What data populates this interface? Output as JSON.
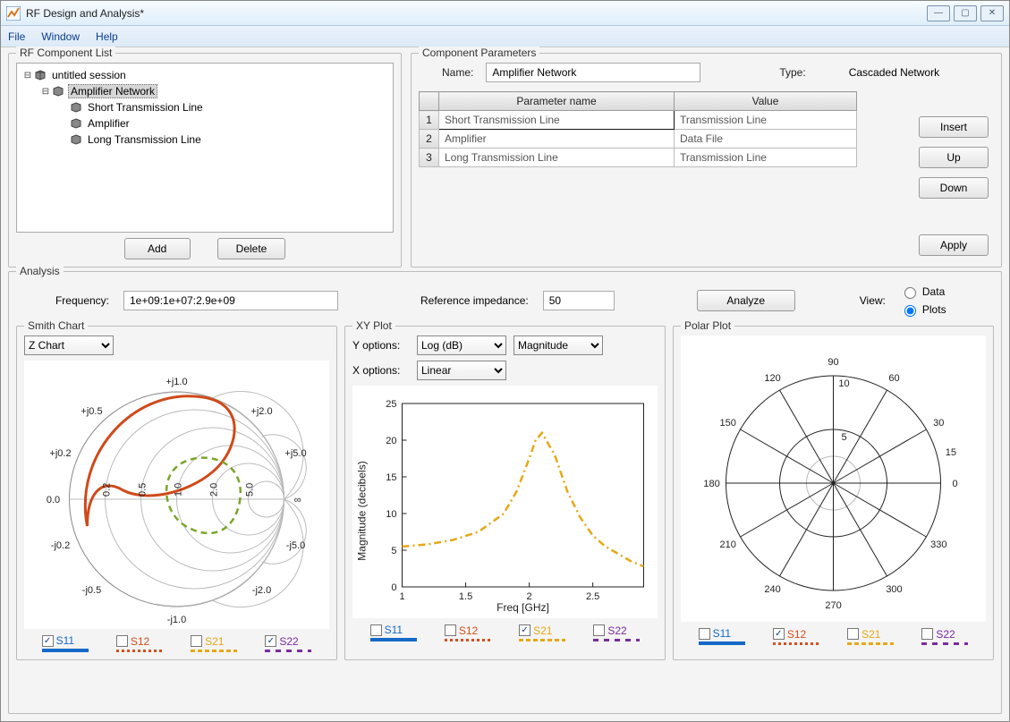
{
  "window": {
    "title": "RF Design and Analysis*"
  },
  "menu": {
    "file": "File",
    "window": "Window",
    "help": "Help"
  },
  "component_list": {
    "legend": "RF Component List",
    "root": "untitled session",
    "selected": "Amplifier Network",
    "children": [
      "Short Transmission Line",
      "Amplifier",
      "Long Transmission Line"
    ],
    "add": "Add",
    "delete": "Delete"
  },
  "params": {
    "legend": "Component Parameters",
    "name_label": "Name:",
    "name_value": "Amplifier Network",
    "type_label": "Type:",
    "type_value": "Cascaded Network",
    "col_param": "Parameter name",
    "col_value": "Value",
    "rows": [
      {
        "n": "1",
        "p": "Short Transmission Line",
        "v": "Transmission Line"
      },
      {
        "n": "2",
        "p": "Amplifier",
        "v": "Data File"
      },
      {
        "n": "3",
        "p": "Long Transmission Line",
        "v": "Transmission Line"
      }
    ],
    "insert": "Insert",
    "up": "Up",
    "down": "Down",
    "apply": "Apply"
  },
  "analysis": {
    "legend": "Analysis",
    "freq_label": "Frequency:",
    "freq_value": "1e+09:1e+07:2.9e+09",
    "ref_label": "Reference impedance:",
    "ref_value": "50",
    "analyze": "Analyze",
    "view_label": "View:",
    "data": "Data",
    "plots": "Plots"
  },
  "smith": {
    "legend": "Smith Chart",
    "zchart": "Z Chart",
    "labels": {
      "pj10": "+j1.0",
      "pj05": "+j0.5",
      "pj20": "+j2.0",
      "pj02": "+j0.2",
      "pj50": "+j5.0",
      "zero": "0.0",
      "inf": "∞",
      "mj02": "-j0.2",
      "mj50": "-j5.0",
      "mj05": "-j0.5",
      "mj20": "-j2.0",
      "mj10": "-j1.0",
      "r02": "0.2",
      "r05": "0.5",
      "r10": "1.0",
      "r20": "2.0",
      "r50": "5.0"
    }
  },
  "xy": {
    "legend": "XY Plot",
    "yopt_label": "Y options:",
    "xopt_label": "X options:",
    "yopt1": "Log (dB)",
    "yopt2": "Magnitude",
    "xopt": "Linear",
    "ylabel": "Magnitude (decibels)",
    "xlabel": "Freq [GHz]"
  },
  "polar": {
    "legend": "Polar Plot"
  },
  "sparam": {
    "s11": "S11",
    "s12": "S12",
    "s21": "S21",
    "s22": "S22"
  },
  "chart_data": [
    {
      "type": "smith",
      "title": "Smith Chart (Z Chart)",
      "series": [
        {
          "name": "S11",
          "style": "solid",
          "color": "#cf4a1a",
          "data_note": "impedance locus roughly forming large loop in upper-left region"
        },
        {
          "name": "S22",
          "style": "dashed",
          "color": "#7aa52a",
          "data_note": "smaller dashed loop near center-right"
        }
      ],
      "checked": [
        "S11",
        "S22"
      ]
    },
    {
      "type": "line",
      "title": "XY Plot",
      "xlabel": "Freq [GHz]",
      "ylabel": "Magnitude (decibels)",
      "xlim": [
        1.0,
        2.9
      ],
      "ylim": [
        0,
        25
      ],
      "xticks": [
        1,
        1.5,
        2,
        2.5
      ],
      "yticks": [
        0,
        5,
        10,
        15,
        20,
        25
      ],
      "series": [
        {
          "name": "S21",
          "color": "#e6a817",
          "style": "dash-dot",
          "x": [
            1.0,
            1.2,
            1.4,
            1.6,
            1.8,
            1.9,
            2.0,
            2.05,
            2.1,
            2.2,
            2.3,
            2.4,
            2.5,
            2.6,
            2.7,
            2.8,
            2.9
          ],
          "values": [
            5.5,
            5.8,
            6.4,
            7.5,
            10.0,
            13.0,
            17.5,
            20.0,
            21.0,
            18.0,
            13.0,
            9.5,
            7.0,
            5.5,
            4.5,
            3.5,
            2.8
          ]
        }
      ],
      "checked": [
        "S21"
      ]
    },
    {
      "type": "polar",
      "title": "Polar Plot",
      "angle_ticks": [
        0,
        15,
        30,
        60,
        90,
        120,
        150,
        180,
        210,
        240,
        270,
        300,
        330
      ],
      "radius_ticks": [
        5,
        10
      ],
      "series": [
        {
          "name": "S12",
          "color": "#d64e1a",
          "data_note": "near origin, not visible at this scale"
        }
      ],
      "checked": [
        "S12"
      ]
    }
  ]
}
